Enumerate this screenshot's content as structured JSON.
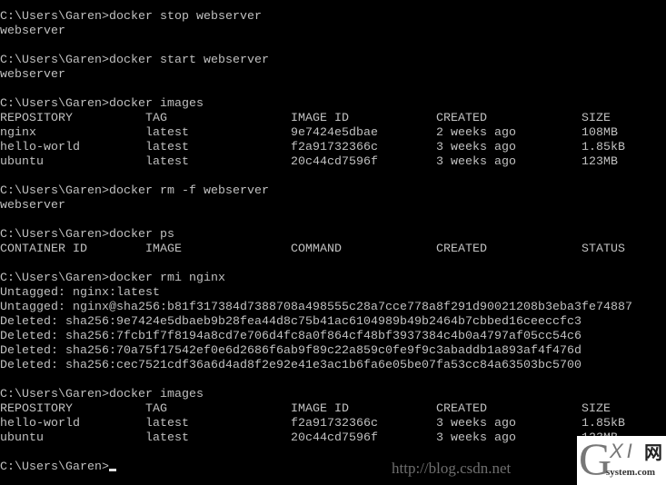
{
  "terminal": {
    "prompt": "C:\\Users\\Garen>",
    "blocks": [
      {
        "command": "docker stop webserver",
        "output": [
          "webserver"
        ]
      },
      {
        "command": "docker start webserver",
        "output": [
          "webserver"
        ]
      },
      {
        "command": "docker images",
        "table": {
          "headers": [
            "REPOSITORY",
            "TAG",
            "IMAGE ID",
            "CREATED",
            "SIZE"
          ],
          "rows": [
            [
              "nginx",
              "latest",
              "9e7424e5dbae",
              "2 weeks ago",
              "108MB"
            ],
            [
              "hello-world",
              "latest",
              "f2a91732366c",
              "3 weeks ago",
              "1.85kB"
            ],
            [
              "ubuntu",
              "latest",
              "20c44cd7596f",
              "3 weeks ago",
              "123MB"
            ]
          ]
        }
      },
      {
        "command": "docker rm -f webserver",
        "output": [
          "webserver"
        ]
      },
      {
        "command": "docker ps",
        "table": {
          "headers": [
            "CONTAINER ID",
            "IMAGE",
            "COMMAND",
            "CREATED",
            "STATUS"
          ],
          "rows": []
        }
      },
      {
        "command": "docker rmi nginx",
        "output": [
          "Untagged: nginx:latest",
          "Untagged: nginx@sha256:b81f317384d7388708a498555c28a7cce778a8f291d90021208b3eba3fe74887",
          "Deleted: sha256:9e7424e5dbaeb9b28fea44d8c75b41ac6104989b49b2464b7cbbed16ceeccfc3",
          "Deleted: sha256:7fcb1f7f8194a8cd7e706d4fc8a0f864cf48bf3937384c4b0a4797af05cc54c6",
          "Deleted: sha256:70a75f17542ef0e6d2686f6ab9f89c22a859c0fe9f9c3abaddb1a893af4f476d",
          "Deleted: sha256:cec7521cdf36a6d4ad8f2e92e41e3ac1b6fa6e05be07fa53cc84a63503bc5700"
        ]
      },
      {
        "command": "docker images",
        "table": {
          "headers": [
            "REPOSITORY",
            "TAG",
            "IMAGE ID",
            "CREATED",
            "SIZE"
          ],
          "rows": [
            [
              "hello-world",
              "latest",
              "f2a91732366c",
              "3 weeks ago",
              "1.85kB"
            ],
            [
              "ubuntu",
              "latest",
              "20c44cd7596f",
              "3 weeks ago",
              "123MB"
            ]
          ]
        }
      }
    ],
    "final_prompt": "C:\\Users\\Garen>"
  },
  "watermark": {
    "url": "http://blog.csdn.net",
    "logo_g": "G",
    "logo_xi": "XI",
    "logo_wang": "网",
    "logo_domain": "system.com"
  }
}
